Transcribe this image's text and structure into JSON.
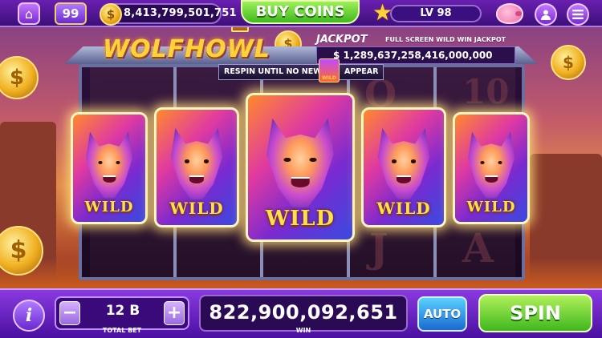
{
  "header": {
    "level_badge": "99",
    "coin_symbol": "$",
    "coins": "8,413,799,501,751",
    "buy_coins": "BUY COINS",
    "player_level": "LV 98"
  },
  "game": {
    "logo": "WOLFHOWL",
    "jackpot_label": "JACKPOT",
    "jackpot_subtitle": "FULL SCREEN WILD WIN JACKPOT",
    "jackpot_amount": "$ 1,289,637,258,416,000,000",
    "respin_left": "RESPIN UNTIL NO NEW",
    "respin_right": "APPEAR",
    "respin_wild": "WILD",
    "wild_label": "WILD",
    "background_symbols": [
      "Q",
      "10",
      "J",
      "A"
    ]
  },
  "controls": {
    "info": "i",
    "minus": "−",
    "plus": "+",
    "total_bet": "12 B",
    "total_bet_label": "TOTAL BET",
    "win_amount": "822,900,092,651",
    "win_label": "WIN",
    "auto": "AUTO",
    "spin": "SPIN"
  },
  "colors": {
    "accent_purple": "#6a1fb0",
    "buy_green": "#3fb81e",
    "gold": "#ffd23a",
    "auto_blue": "#1a6ad0"
  }
}
